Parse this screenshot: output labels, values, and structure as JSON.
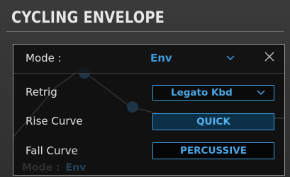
{
  "panel": {
    "title": "CYCLING ENVELOPE"
  },
  "popup": {
    "mode_label": "Mode :",
    "mode_value": "Env",
    "background_text": {
      "label": "Mode :",
      "value": "Env"
    },
    "rows": [
      {
        "label": "Retrig",
        "value": "Legato Kbd",
        "control": "dropdown"
      },
      {
        "label": "Rise Curve",
        "value": "QUICK",
        "control": "toggle-active"
      },
      {
        "label": "Fall Curve",
        "value": "PERCUSSIVE",
        "control": "toggle"
      }
    ]
  },
  "colors": {
    "accent": "#3c9bdc",
    "active_fill": "#0c3047",
    "text": "#e2e2e2"
  },
  "icons": {
    "mode_dropdown": "chevron-down-icon",
    "retrig_dropdown": "chevron-down-icon",
    "close": "close-icon"
  }
}
